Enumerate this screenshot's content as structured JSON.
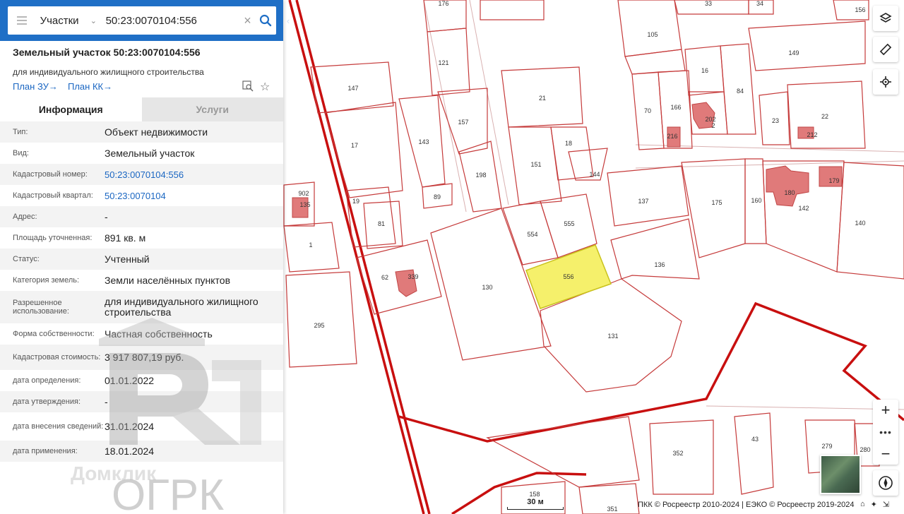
{
  "search": {
    "type": "Участки",
    "query": "50:23:0070104:556"
  },
  "object": {
    "title": "Земельный участок 50:23:0070104:556",
    "subtitle": "для индивидуального жилищного строительства",
    "plan_zu": "План ЗУ",
    "plan_kk": "План КК",
    "arrow": "→"
  },
  "tabs": {
    "info": "Информация",
    "services": "Услуги"
  },
  "info_rows": [
    {
      "label": "Тип:",
      "value": "Объект недвижимости"
    },
    {
      "label": "Вид:",
      "value": "Земельный участок"
    },
    {
      "label": "Кадастровый номер:",
      "value": "50:23:0070104:556"
    },
    {
      "label": "Кадастровый квартал:",
      "value": "50:23:0070104"
    },
    {
      "label": "Адрес:",
      "value": "-"
    },
    {
      "label": "Площадь уточненная:",
      "value": "891 кв. м"
    },
    {
      "label": "Статус:",
      "value": "Учтенный"
    },
    {
      "label": "Категория земель:",
      "value": "Земли населённых пунктов"
    },
    {
      "label": "Разрешенное использование:",
      "value": "для индивидуального жилищного строительства"
    },
    {
      "label": "Форма собственности:",
      "value": "Частная собственность"
    },
    {
      "label": "Кадастровая стоимость:",
      "value": "3 917 807,19 руб."
    },
    {
      "label": "дата определения:",
      "value": "01.01.2022"
    },
    {
      "label": "дата утверждения:",
      "value": "-"
    },
    {
      "label": "дата внесения сведений:",
      "value": "31.01.2024"
    },
    {
      "label": "дата применения:",
      "value": "18.01.2024"
    }
  ],
  "watermark": {
    "text": "ОГРК",
    "sub": "Домклик"
  },
  "map": {
    "parcel_labels": [
      "176",
      "33",
      "34",
      "156",
      "105",
      "121",
      "149",
      "147",
      "16",
      "84",
      "21",
      "70",
      "166",
      "202",
      "2",
      "23",
      "22",
      "212",
      "17",
      "143",
      "157",
      "18",
      "151",
      "144",
      "216",
      "198",
      "180",
      "179",
      "142",
      "902",
      "135",
      "19",
      "89",
      "137",
      "175",
      "160",
      "140",
      "81",
      "554",
      "555",
      "1",
      "136",
      "556",
      "62",
      "339",
      "130",
      "295",
      "131",
      "43",
      "352",
      "279",
      "280",
      "158",
      "351"
    ],
    "selected_parcel": "556"
  },
  "footer": {
    "scale": "30 м",
    "copyright": "ПКК © Росреестр 2010-2024 | ЕЭКО © Росреестр 2019-2024"
  },
  "colors": {
    "header": "#1f6fc6",
    "parcel_stroke": "#c53a3a",
    "road": "#c80f0f",
    "selected": "#f5f06b",
    "link": "#1a66c2"
  }
}
